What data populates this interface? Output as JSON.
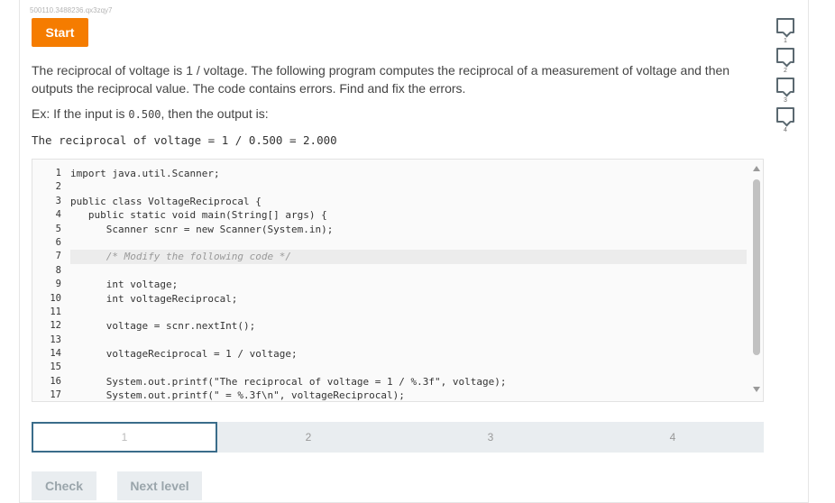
{
  "challenge_id": "500110.3488236.qx3zqy7",
  "start_label": "Start",
  "prompt": "The reciprocal of voltage is 1 / voltage. The following program computes the reciprocal of a measurement of voltage and then outputs the reciprocal value. The code contains errors. Find and fix the errors.",
  "example": {
    "prefix": "Ex: If the input is ",
    "input": "0.500",
    "suffix": ", then the output is:"
  },
  "output_line": "The reciprocal of voltage = 1 / 0.500 = 2.000",
  "code": {
    "line_numbers": [
      "1",
      "2",
      "3",
      "4",
      "5",
      "6",
      "7",
      "8",
      "9",
      "10",
      "11",
      "12",
      "13",
      "14",
      "15",
      "16",
      "17"
    ],
    "lines": [
      "import java.util.Scanner;",
      "",
      "public class VoltageReciprocal {",
      "   public static void main(String[] args) {",
      "      Scanner scnr = new Scanner(System.in);",
      "",
      "      /* Modify the following code */",
      "",
      "      int voltage;",
      "      int voltageReciprocal;",
      "",
      "      voltage = scnr.nextInt();",
      "",
      "      voltageReciprocal = 1 / voltage;",
      "",
      "      System.out.printf(\"The reciprocal of voltage = 1 / %.3f\", voltage);",
      "      System.out.printf(\" = %.3f\\n\", voltageReciprocal);"
    ]
  },
  "levels": [
    "1",
    "2",
    "3",
    "4"
  ],
  "current_level": "1",
  "check_label": "Check",
  "next_label": "Next level",
  "progress": [
    "1",
    "2",
    "3",
    "4"
  ]
}
